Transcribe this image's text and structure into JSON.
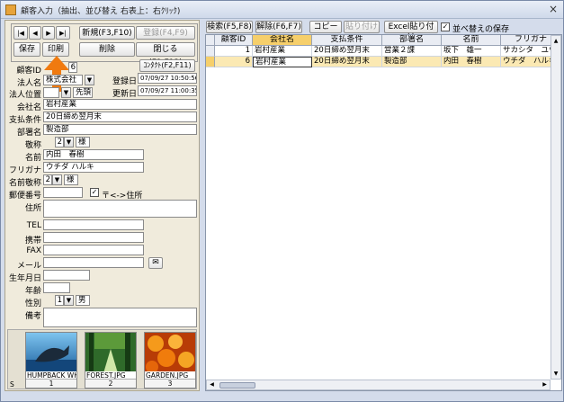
{
  "window": {
    "title": "顧客入力（抽出、並び替え 右表上：右ｸﾘｯｸ)",
    "close": "×"
  },
  "nav": {
    "first": "|◀",
    "prev": "◀",
    "next": "▶",
    "last": "▶|"
  },
  "toolbar": {
    "new_label": "新規(F3,F10)",
    "register_label": "登録(F4,F9)",
    "save_label": "保存",
    "print_label": "印刷",
    "delete_label": "削除",
    "close_label": "閉じる(F1,F12)",
    "contact_label": "ｺﾝﾀｸﾄ(F2,F11)"
  },
  "form": {
    "customer_id_label": "顧客ID",
    "customer_id": "6",
    "corp_name_label": "法人名",
    "corp_name": "株式会社",
    "corp_pos_label": "法人位置",
    "corp_pos_value": "先頭",
    "reg_date_label": "登録日",
    "reg_date": "07/09/27 10:50:56",
    "upd_date_label": "更新日",
    "upd_date": "07/09/27 11:00:35",
    "company_label": "会社名",
    "company": "岩村産業",
    "payment_label": "支払条件",
    "payment": "20日締め翌月末",
    "dept_label": "部署名",
    "dept": "製造部",
    "honorific_label": "敬称",
    "honorific_num": "2",
    "honorific": "様",
    "name_label": "名前",
    "name": "内田　春樹",
    "furigana_label": "フリガナ",
    "furigana": "ウチダ ハルキ",
    "name_hon_label": "名前敬称",
    "name_hon_num": "2",
    "name_hon": "様",
    "zip_label": "郵便番号",
    "zip_addr_label": "〒<->住所",
    "address_label": "住所",
    "tel_label": "TEL",
    "mobile_label": "携帯",
    "fax_label": "FAX",
    "mail_label": "メール",
    "birthday_label": "生年月日",
    "age_label": "年齢",
    "gender_label": "性別",
    "gender_num": "1",
    "gender": "男",
    "notes_label": "備考"
  },
  "thumbnails": [
    {
      "caption": "HUMPBACK WH",
      "index": "1"
    },
    {
      "caption": "FOREST.JPG",
      "index": "2"
    },
    {
      "caption": "GARDEN.JPG",
      "index": "3"
    }
  ],
  "thumb_s": "S",
  "right_toolbar": {
    "search": "検索(F5,F8)",
    "clear": "解除(F6,F7)",
    "copy": "コピー",
    "paste": "貼り付け",
    "excel_paste": "Excel貼り付け",
    "save_sort": "並べ替えの保存"
  },
  "table": {
    "headers": [
      "顧客ID",
      "会社名",
      "支払条件",
      "部署名",
      "名前",
      "フリガナ"
    ],
    "rows": [
      [
        "1",
        "岩村産業",
        "20日締め翌月末",
        "営業２課",
        "坂下　雄一",
        "サカシタ　ユウ"
      ],
      [
        "6",
        "岩村産業",
        "20日締め翌月末",
        "製造部",
        "内田　春樹",
        "ウチダ　ハルキ"
      ]
    ]
  },
  "colors": {
    "arrow": "#f07a10",
    "header_selected": "#f6cf6b"
  }
}
